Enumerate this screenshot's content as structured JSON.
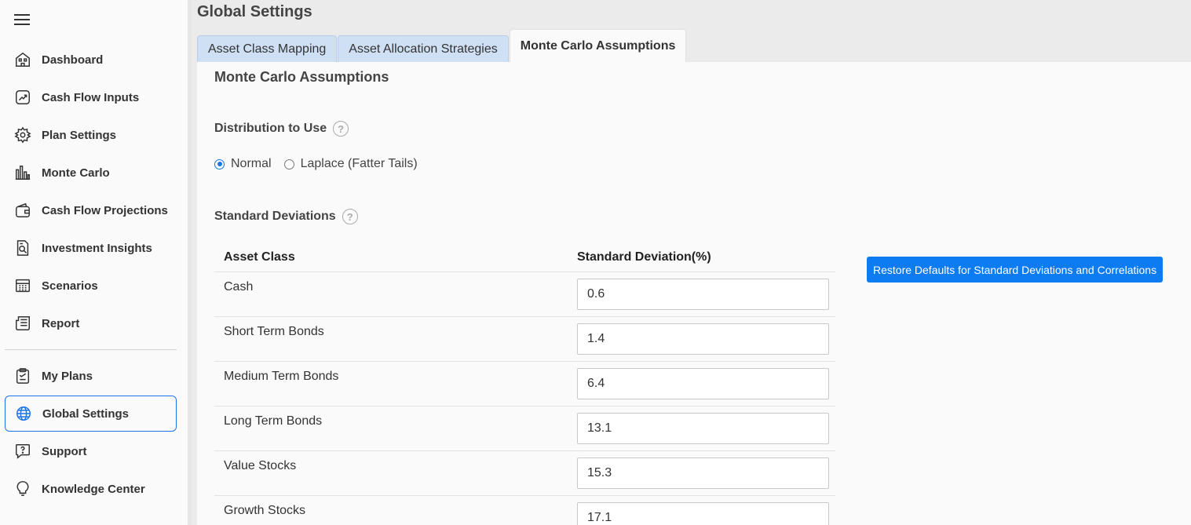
{
  "sidebar": {
    "items": [
      {
        "label": "Dashboard",
        "icon": "dashboard-icon"
      },
      {
        "label": "Cash Flow Inputs",
        "icon": "cash-flow-inputs-icon"
      },
      {
        "label": "Plan Settings",
        "icon": "gear-icon"
      },
      {
        "label": "Monte Carlo",
        "icon": "bar-chart-icon"
      },
      {
        "label": "Cash Flow Projections",
        "icon": "wallet-icon"
      },
      {
        "label": "Investment Insights",
        "icon": "document-search-icon"
      },
      {
        "label": "Scenarios",
        "icon": "calculator-icon"
      },
      {
        "label": "Report",
        "icon": "newspaper-icon"
      }
    ],
    "bottom_items": [
      {
        "label": "My Plans",
        "icon": "clipboard-icon"
      },
      {
        "label": "Global Settings",
        "icon": "globe-icon",
        "active": true
      },
      {
        "label": "Support",
        "icon": "help-chat-icon"
      },
      {
        "label": "Knowledge Center",
        "icon": "lightbulb-icon"
      }
    ]
  },
  "header": {
    "title": "Global Settings"
  },
  "tabs": [
    {
      "label": "Asset Class Mapping"
    },
    {
      "label": "Asset Allocation Strategies"
    },
    {
      "label": "Monte Carlo Assumptions",
      "active": true
    }
  ],
  "main": {
    "section_title": "Monte Carlo Assumptions",
    "distribution_label": "Distribution to Use",
    "distribution_options": [
      {
        "label": "Normal",
        "checked": true
      },
      {
        "label": "Laplace (Fatter Tails)",
        "checked": false
      }
    ],
    "stddev_label": "Standard Deviations",
    "table": {
      "headers": [
        "Asset Class",
        "Standard Deviation(%)"
      ],
      "rows": [
        {
          "asset": "Cash",
          "value": "0.6"
        },
        {
          "asset": "Short Term Bonds",
          "value": "1.4"
        },
        {
          "asset": "Medium Term Bonds",
          "value": "6.4"
        },
        {
          "asset": "Long Term Bonds",
          "value": "13.1"
        },
        {
          "asset": "Value Stocks",
          "value": "15.3"
        },
        {
          "asset": "Growth Stocks",
          "value": "17.1"
        }
      ]
    },
    "restore_button": "Restore Defaults for Standard Deviations and Correlations"
  },
  "colors": {
    "accent": "#0d7bf2",
    "tab_inactive": "#cfe0f5"
  }
}
